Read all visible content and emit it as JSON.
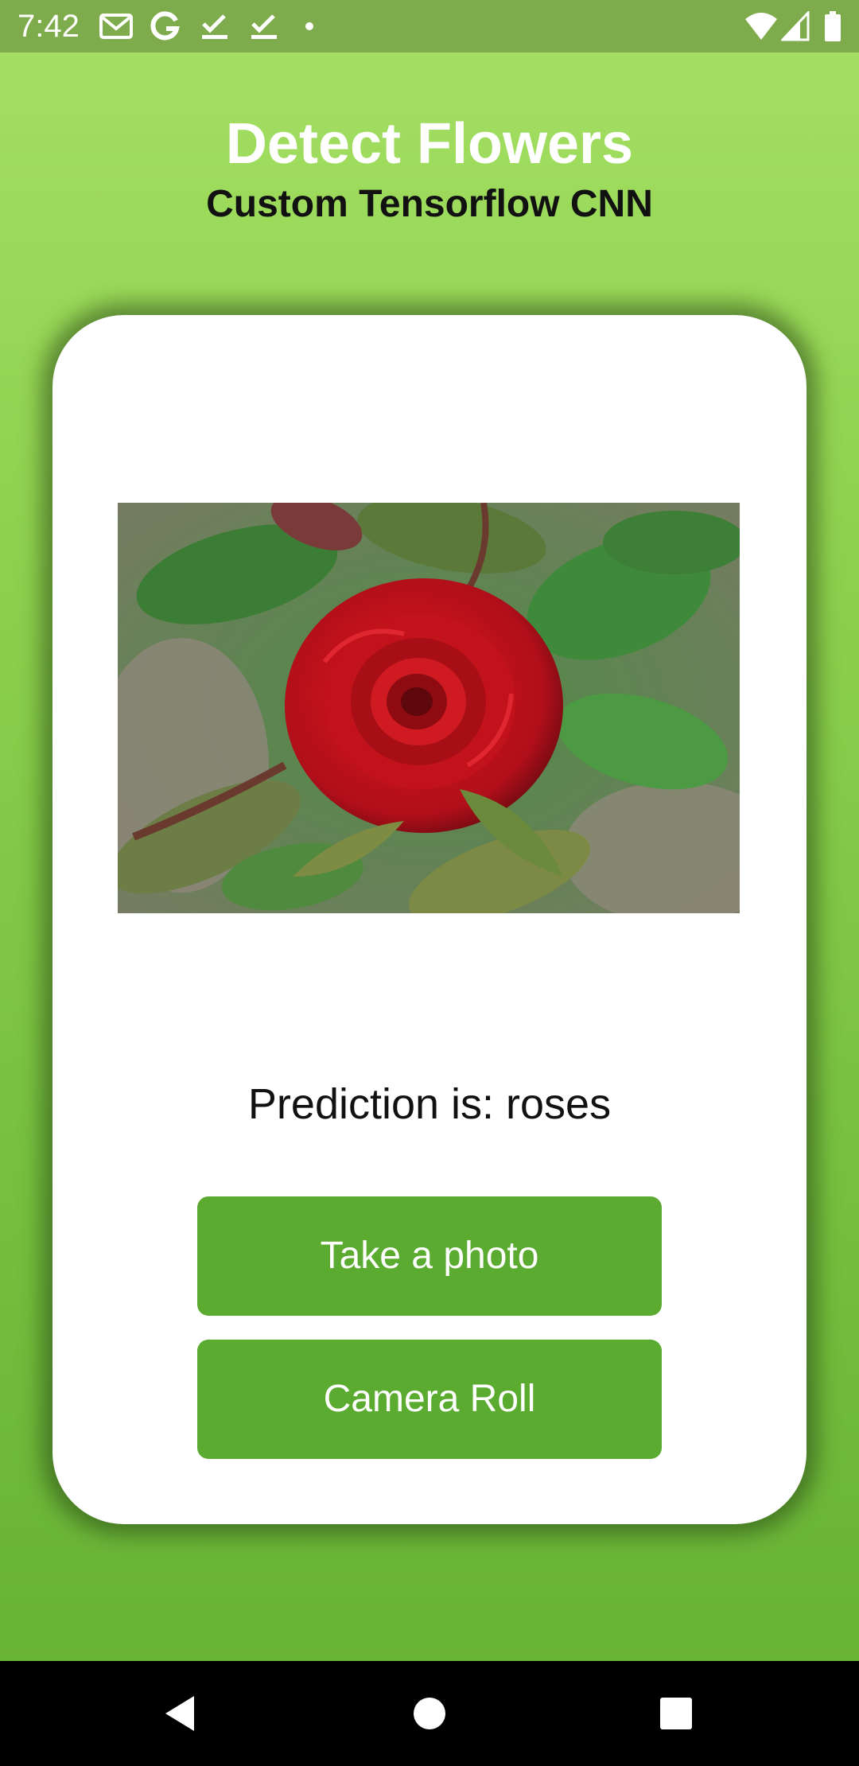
{
  "status_bar": {
    "time": "7:42",
    "icons": [
      "gmail-icon",
      "google-icon",
      "check-icon",
      "check-icon",
      "dot-icon",
      "wifi-icon",
      "signal-icon",
      "battery-icon"
    ]
  },
  "header": {
    "title": "Detect Flowers",
    "subtitle": "Custom Tensorflow CNN"
  },
  "card": {
    "image_subject": "rose-photo",
    "prediction_prefix": "Prediction is: ",
    "prediction_value": "roses",
    "buttons": {
      "take_photo": "Take a photo",
      "camera_roll": "Camera Roll"
    }
  },
  "nav_bar": {
    "buttons": [
      "back-icon",
      "home-icon",
      "recents-icon"
    ]
  },
  "colors": {
    "background_top": "#a5e064",
    "background_bottom": "#64b034",
    "status_bar": "#7eab4b",
    "button": "#5aab30",
    "card": "#ffffff"
  }
}
